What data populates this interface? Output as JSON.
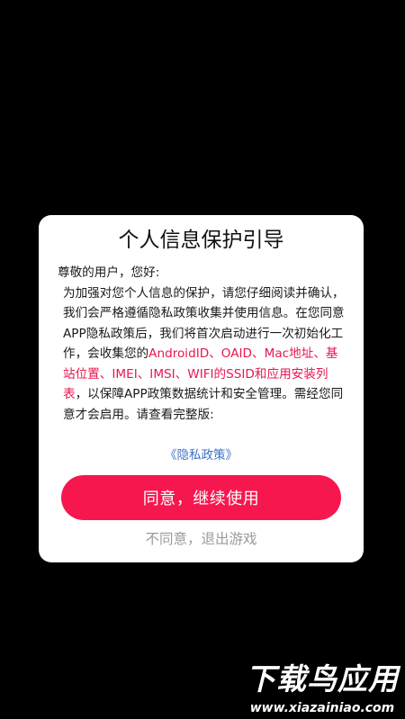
{
  "dialog": {
    "title": "个人信息保护引导",
    "greeting": "尊敬的用户，您好:",
    "paragraph_part1": "为加强对您个人信息的保护，请您仔细阅读并确认，我们会严格遵循隐私政策收集并使用信息。在您同意APP隐私政策后，我们将首次启动进行一次初始化工作，会收集您的",
    "paragraph_highlight": "AndroidID、OAID、Mac地址、基站位置、IMEI、IMSI、WIFI的SSID和应用安装列表",
    "paragraph_part2": "，以保障APP政策数据统计和安全管理。需经您同意才会启用。请查看完整版:",
    "policy_link": "《隐私政策》",
    "agree_label": "同意，继续使用",
    "disagree_label": "不同意，退出游戏"
  },
  "watermark": {
    "title": "下载鸟应用",
    "url": "www.xiazainiao.com"
  },
  "colors": {
    "highlight": "#e8174f",
    "button": "#f7174f",
    "link": "#3d72c6",
    "background": "#000000"
  }
}
